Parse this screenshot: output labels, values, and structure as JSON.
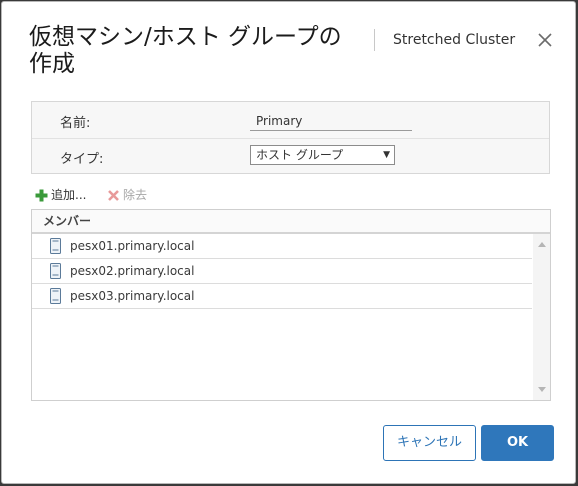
{
  "dialog": {
    "title": "仮想マシン/ホスト グループの作成",
    "subtitle": "Stretched Cluster",
    "close_icon": "close-icon"
  },
  "form": {
    "name_label": "名前:",
    "name_value": "Primary",
    "type_label": "タイプ:",
    "type_value": "ホスト グループ"
  },
  "toolbar": {
    "add_label": "追加...",
    "remove_label": "除去",
    "add_icon": "plus-icon",
    "remove_icon": "remove-x-icon"
  },
  "members": {
    "header": "メンバー",
    "items": [
      {
        "name": "pesx01.primary.local",
        "icon": "host-icon"
      },
      {
        "name": "pesx02.primary.local",
        "icon": "host-icon"
      },
      {
        "name": "pesx03.primary.local",
        "icon": "host-icon"
      }
    ]
  },
  "buttons": {
    "cancel": "キャンセル",
    "ok": "OK"
  },
  "colors": {
    "accent": "#2f77bb",
    "add_icon": "#3a9a3a",
    "remove_icon": "#e06b6b"
  }
}
